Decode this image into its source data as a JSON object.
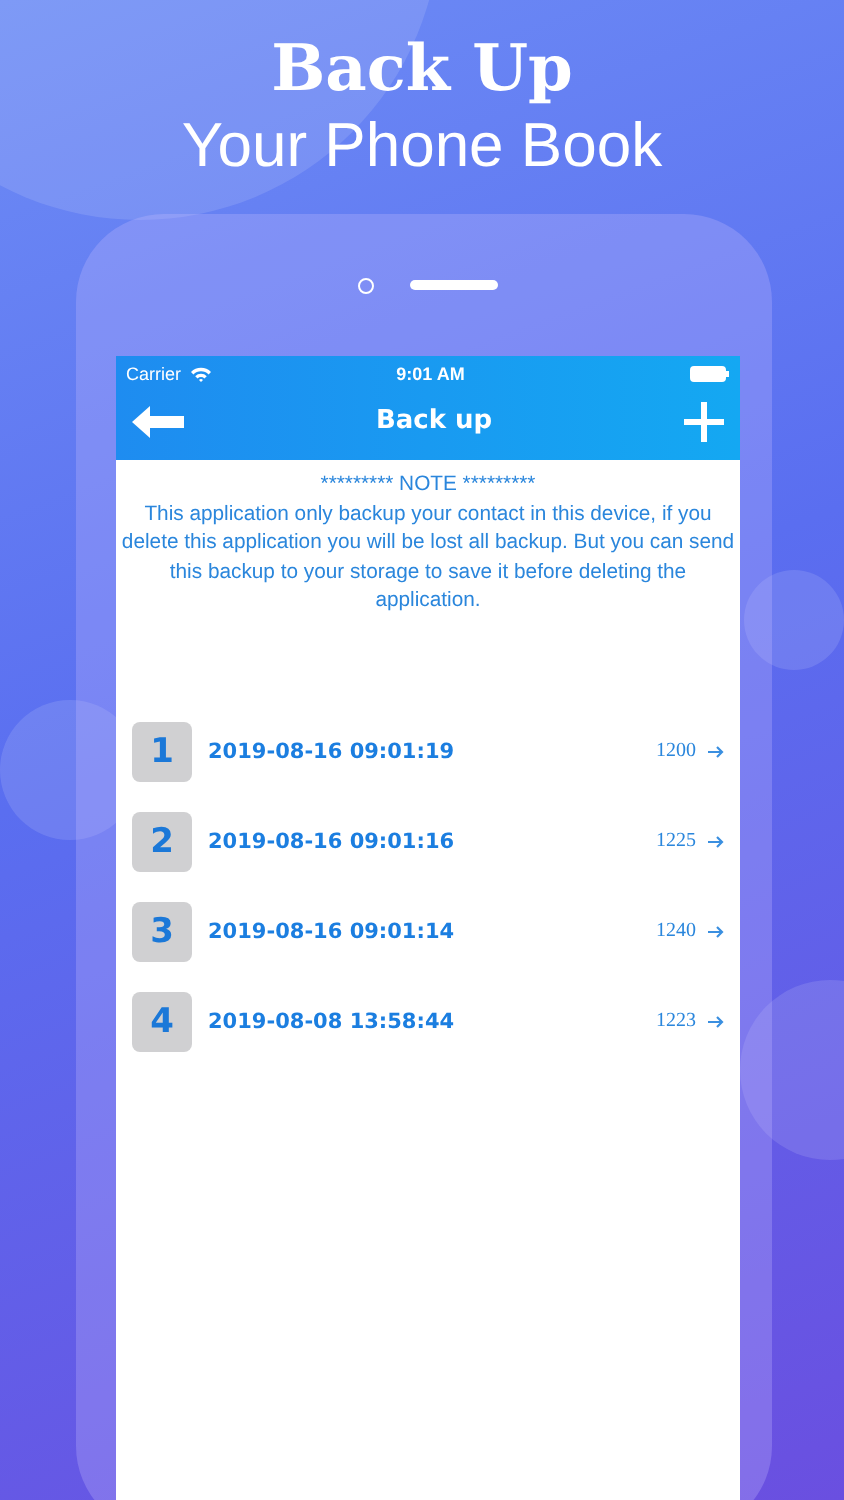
{
  "headline": {
    "title": "Back Up",
    "subtitle": "Your Phone Book"
  },
  "status_bar": {
    "carrier": "Carrier",
    "time": "9:01 AM"
  },
  "nav_bar": {
    "title": "Back up"
  },
  "note": {
    "heading": "********* NOTE *********",
    "text": "This application only backup your contact in this device, if you delete this application you will be lost all backup. But you can send this backup to your storage to save it before deleting the application."
  },
  "backups": [
    {
      "index": "1",
      "date": "2019-08-16 09:01:19",
      "count": "1200"
    },
    {
      "index": "2",
      "date": "2019-08-16 09:01:16",
      "count": "1225"
    },
    {
      "index": "3",
      "date": "2019-08-16 09:01:14",
      "count": "1240"
    },
    {
      "index": "4",
      "date": "2019-08-08 13:58:44",
      "count": "1223"
    }
  ]
}
